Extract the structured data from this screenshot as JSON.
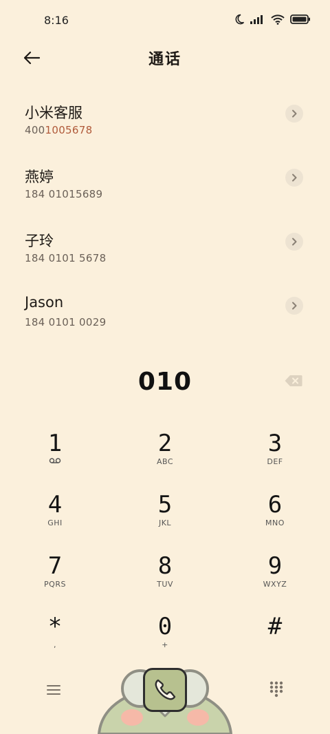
{
  "status": {
    "time": "8:16"
  },
  "header": {
    "title": "通话"
  },
  "contacts": [
    {
      "name": "小米客服",
      "number_before": "400",
      "number_match": "1005678",
      "number_after": "",
      "number_full": "4001005678"
    },
    {
      "name": "燕婷",
      "number_full": "184 01015689"
    },
    {
      "name": "子玲",
      "number_full": "184 0101 5678"
    },
    {
      "name": "Jason",
      "number_full": "184 0101 0029"
    }
  ],
  "dialer": {
    "entered": "010"
  },
  "keypad": [
    {
      "digit": "1",
      "sub": ""
    },
    {
      "digit": "2",
      "sub": "ABC"
    },
    {
      "digit": "3",
      "sub": "DEF"
    },
    {
      "digit": "4",
      "sub": "GHI"
    },
    {
      "digit": "5",
      "sub": "JKL"
    },
    {
      "digit": "6",
      "sub": "MNO"
    },
    {
      "digit": "7",
      "sub": "PQRS"
    },
    {
      "digit": "8",
      "sub": "TUV"
    },
    {
      "digit": "9",
      "sub": "WXYZ"
    },
    {
      "digit": "*",
      "sub": ","
    },
    {
      "digit": "0",
      "sub": "+"
    },
    {
      "digit": "#",
      "sub": ""
    }
  ],
  "colors": {
    "background": "#FBF0DC",
    "call_button": "#B7C18F",
    "highlight": "#B05A3A"
  },
  "icons": {
    "keypad_1": "voicemail-icon",
    "menu": "menu-icon",
    "dialpad": "dialpad-icon",
    "call": "phone-icon"
  }
}
